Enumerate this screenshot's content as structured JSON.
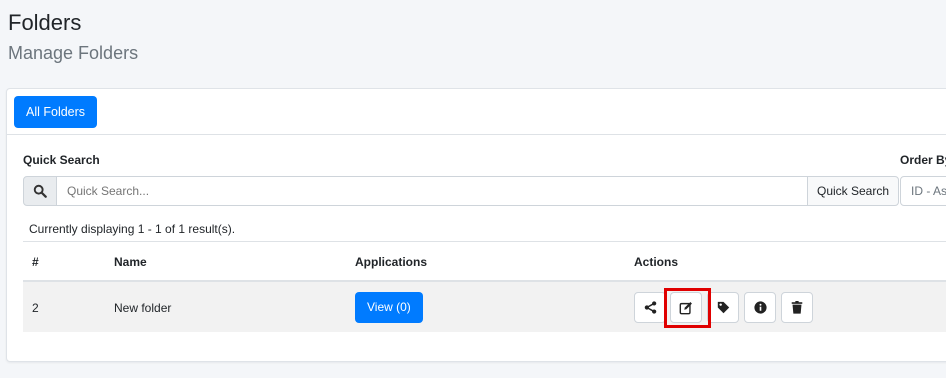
{
  "header": {
    "title": "Folders",
    "subtitle": "Manage Folders"
  },
  "card": {
    "tab_label": "All Folders",
    "quick_search_label": "Quick Search",
    "order_by_label": "Order By",
    "search_placeholder": "Quick Search...",
    "search_button_label": "Quick Search",
    "order_select_value": "ID - As",
    "result_summary": "Currently displaying 1 - 1 of 1 result(s)."
  },
  "table": {
    "columns": [
      "#",
      "Name",
      "Applications",
      "Actions"
    ],
    "rows": [
      {
        "id": "2",
        "name": "New folder",
        "applications_label": "View (0)",
        "actions": [
          "share-icon",
          "edit-icon",
          "tag-icon",
          "info-icon",
          "trash-icon"
        ]
      }
    ]
  },
  "colors": {
    "primary": "#007bff",
    "highlight": "#e00000",
    "background": "#f4f6f9"
  }
}
